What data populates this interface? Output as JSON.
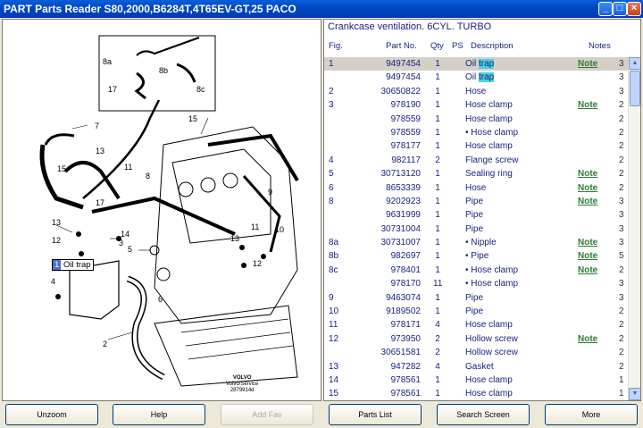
{
  "window": {
    "title": "PART Parts Reader S80,2000,B6284T,4T65EV-GT,25 PACO",
    "min_icon": "minimize-icon",
    "max_icon": "maximize-icon",
    "close_icon": "close-icon"
  },
  "diagram": {
    "callout_labels": [
      "8a",
      "8b",
      "17",
      "8c",
      "7",
      "15",
      "13",
      "11",
      "15",
      "17",
      "8",
      "9",
      "13",
      "14",
      "12",
      "3",
      "5",
      "10",
      "11",
      "13",
      "12",
      "6",
      "4",
      "2",
      "1"
    ],
    "selected_callout_num": "1",
    "selected_callout_text": "Oil trap",
    "logo_line1": "VOLVO",
    "logo_line2": "Volvo/Service",
    "logo_line3": "2879914d"
  },
  "parts": {
    "title": "Crankcase ventilation. 6CYL. TURBO",
    "headers": {
      "fig": "Fig.",
      "part": "Part No.",
      "qty": "Qty",
      "ps": "PS",
      "desc": "Description",
      "notes": "Notes"
    },
    "highlight_term": "trap",
    "rows": [
      {
        "fig": "1",
        "part": "9497454",
        "qty": "1",
        "desc_pre": "Oil ",
        "desc_hl": "trap",
        "note": "Note",
        "count": "3",
        "selected": true
      },
      {
        "fig": "",
        "part": "9497454",
        "qty": "1",
        "desc_pre": "Oil ",
        "desc_hl": "trap",
        "note": "",
        "count": "3"
      },
      {
        "fig": "2",
        "part": "30650822",
        "qty": "1",
        "desc_pre": "Hose",
        "desc_hl": "",
        "note": "",
        "count": "3"
      },
      {
        "fig": "3",
        "part": "978190",
        "qty": "1",
        "desc_pre": "Hose clamp",
        "desc_hl": "",
        "note": "Note",
        "count": "2"
      },
      {
        "fig": "",
        "part": "978559",
        "qty": "1",
        "desc_pre": "Hose clamp",
        "desc_hl": "",
        "note": "",
        "count": "2"
      },
      {
        "fig": "",
        "part": "978559",
        "qty": "1",
        "desc_pre": "• Hose clamp",
        "desc_hl": "",
        "note": "",
        "count": "2"
      },
      {
        "fig": "",
        "part": "978177",
        "qty": "1",
        "desc_pre": "Hose clamp",
        "desc_hl": "",
        "note": "",
        "count": "2"
      },
      {
        "fig": "4",
        "part": "982117",
        "qty": "2",
        "desc_pre": "Flange screw",
        "desc_hl": "",
        "note": "",
        "count": "2"
      },
      {
        "fig": "5",
        "part": "30713120",
        "qty": "1",
        "desc_pre": "Sealing ring",
        "desc_hl": "",
        "note": "Note",
        "count": "2"
      },
      {
        "fig": "6",
        "part": "8653339",
        "qty": "1",
        "desc_pre": "Hose",
        "desc_hl": "",
        "note": "Note",
        "count": "2"
      },
      {
        "fig": "8",
        "part": "9202923",
        "qty": "1",
        "desc_pre": "Pipe",
        "desc_hl": "",
        "note": "Note",
        "count": "3"
      },
      {
        "fig": "",
        "part": "9631999",
        "qty": "1",
        "desc_pre": "Pipe",
        "desc_hl": "",
        "note": "",
        "count": "3"
      },
      {
        "fig": "",
        "part": "30731004",
        "qty": "1",
        "desc_pre": "Pipe",
        "desc_hl": "",
        "note": "",
        "count": "3"
      },
      {
        "fig": "8a",
        "part": "30731007",
        "qty": "1",
        "desc_pre": "• Nipple",
        "desc_hl": "",
        "note": "Note",
        "count": "3"
      },
      {
        "fig": "8b",
        "part": "982697",
        "qty": "1",
        "desc_pre": "• Pipe",
        "desc_hl": "",
        "note": "Note",
        "count": "5"
      },
      {
        "fig": "8c",
        "part": "978401",
        "qty": "1",
        "desc_pre": "• Hose clamp",
        "desc_hl": "",
        "note": "Note",
        "count": "2"
      },
      {
        "fig": "",
        "part": "978170",
        "qty": "11",
        "desc_pre": "• Hose clamp",
        "desc_hl": "",
        "note": "",
        "count": "3"
      },
      {
        "fig": "9",
        "part": "9463074",
        "qty": "1",
        "desc_pre": "Pipe",
        "desc_hl": "",
        "note": "",
        "count": "3"
      },
      {
        "fig": "10",
        "part": "9189502",
        "qty": "1",
        "desc_pre": "Pipe",
        "desc_hl": "",
        "note": "",
        "count": "2"
      },
      {
        "fig": "11",
        "part": "978171",
        "qty": "4",
        "desc_pre": "Hose clamp",
        "desc_hl": "",
        "note": "",
        "count": "2"
      },
      {
        "fig": "12",
        "part": "973950",
        "qty": "2",
        "desc_pre": "Hollow screw",
        "desc_hl": "",
        "note": "Note",
        "count": "2"
      },
      {
        "fig": "",
        "part": "30651581",
        "qty": "2",
        "desc_pre": "Hollow screw",
        "desc_hl": "",
        "note": "",
        "count": "2"
      },
      {
        "fig": "13",
        "part": "947282",
        "qty": "4",
        "desc_pre": "Gasket",
        "desc_hl": "",
        "note": "",
        "count": "2"
      },
      {
        "fig": "14",
        "part": "978561",
        "qty": "1",
        "desc_pre": "Hose clamp",
        "desc_hl": "",
        "note": "",
        "count": "1"
      },
      {
        "fig": "15",
        "part": "978561",
        "qty": "1",
        "desc_pre": "Hose clamp",
        "desc_hl": "",
        "note": "",
        "count": "1"
      }
    ]
  },
  "buttons": {
    "unzoom": "Unzoom",
    "help": "Help",
    "add_fav": "Add Fav",
    "parts_list": "Parts List",
    "search_screen": "Search Screen",
    "more": "More"
  }
}
